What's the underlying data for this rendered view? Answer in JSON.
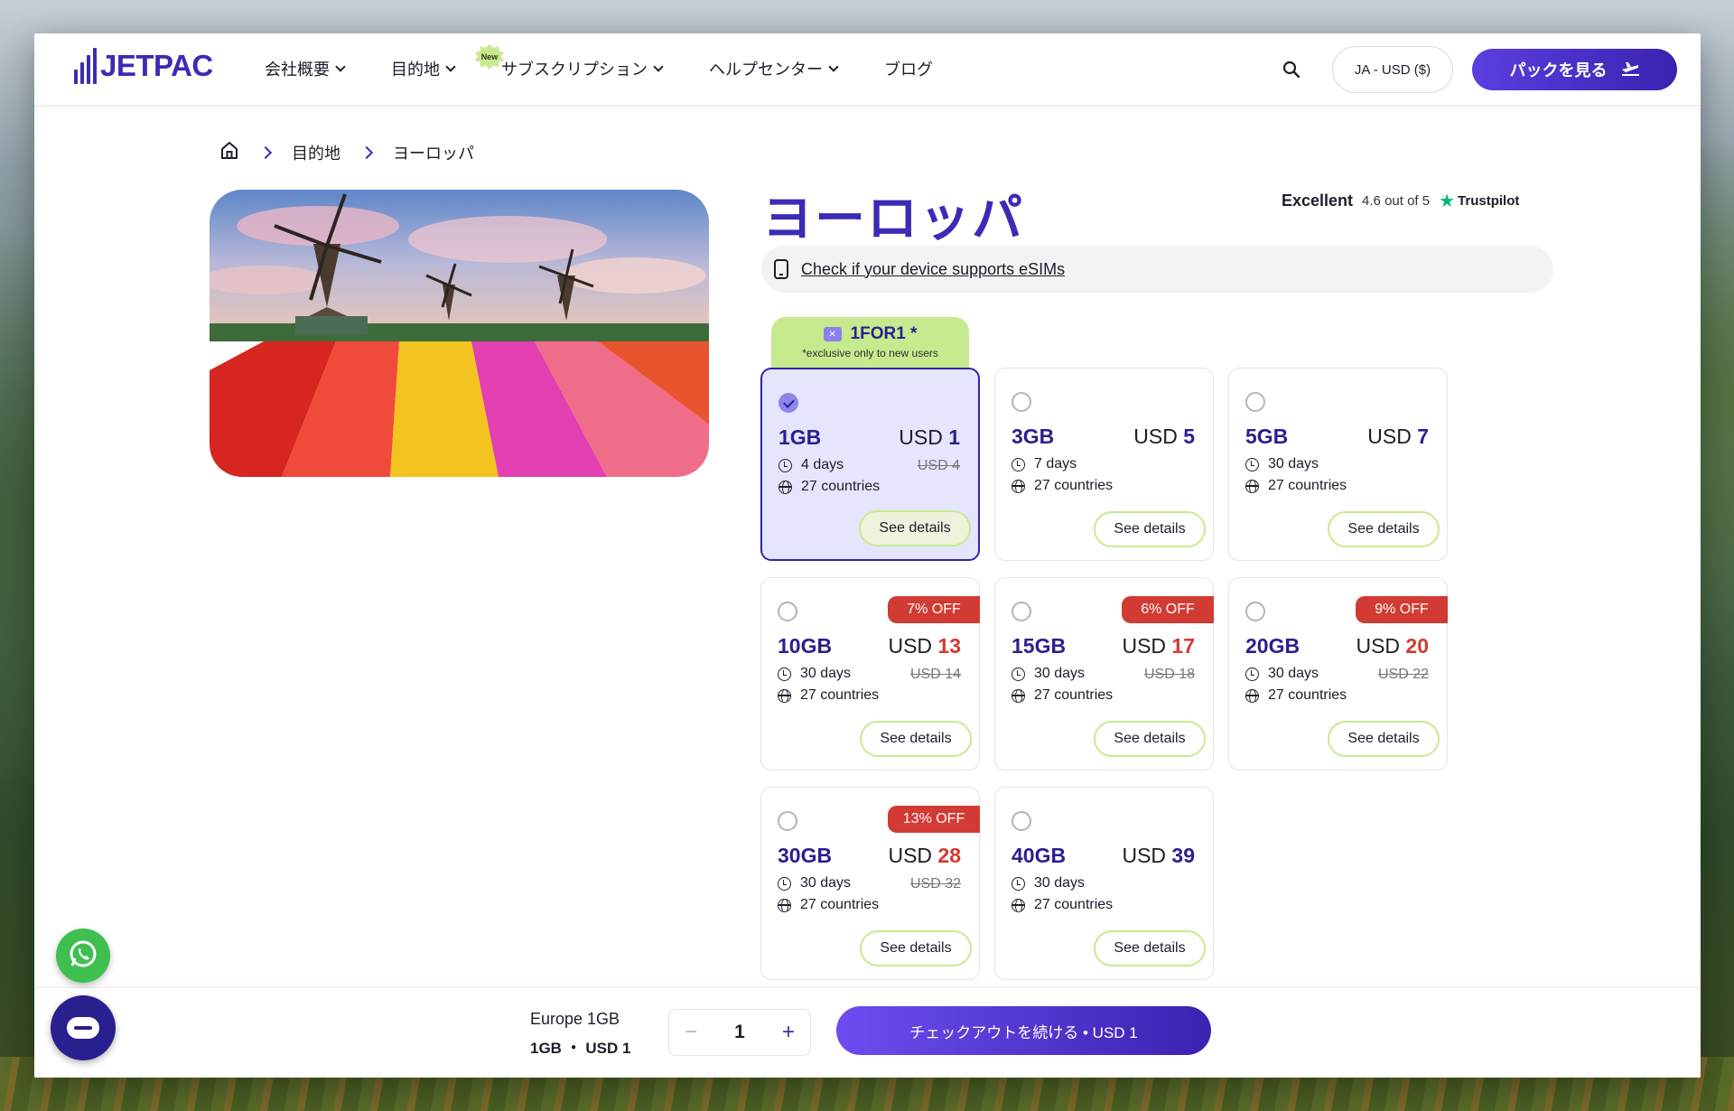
{
  "brand": {
    "name": "JETPAC",
    "accent": "#3b2bb6",
    "sale_color": "#d13b33",
    "promo_color": "#c8ea8f"
  },
  "nav": {
    "items": [
      {
        "label": "会社概要",
        "dropdown": true
      },
      {
        "label": "目的地",
        "dropdown": true
      },
      {
        "label": "サブスクリプション",
        "dropdown": true,
        "badge": "New"
      },
      {
        "label": "ヘルプセンター",
        "dropdown": true
      },
      {
        "label": "ブログ",
        "dropdown": false
      }
    ],
    "search_icon": "search-icon",
    "lang": "JA - USD ($)",
    "cta": "パックを見る"
  },
  "breadcrumb": {
    "home_icon": "home-icon",
    "items": [
      "目的地",
      "ヨーロッパ"
    ]
  },
  "page": {
    "title": "ヨーロッパ",
    "trust": {
      "label": "Excellent",
      "score": "4.6 out of 5",
      "brand": "Trustpilot"
    },
    "esim_check": "Check if your device supports eSIMs"
  },
  "promo": {
    "code": "1FOR1 *",
    "note": "*exclusive only to new users"
  },
  "plans": [
    {
      "gb": "1GB",
      "currency": "USD",
      "price": "1",
      "old": "USD 4",
      "days": "4 days",
      "countries": "27 countries",
      "off": "",
      "selected": true
    },
    {
      "gb": "3GB",
      "currency": "USD",
      "price": "5",
      "old": "",
      "days": "7 days",
      "countries": "27 countries",
      "off": "",
      "selected": false
    },
    {
      "gb": "5GB",
      "currency": "USD",
      "price": "7",
      "old": "",
      "days": "30 days",
      "countries": "27 countries",
      "off": "",
      "selected": false
    },
    {
      "gb": "10GB",
      "currency": "USD",
      "price": "13",
      "old": "USD 14",
      "days": "30 days",
      "countries": "27 countries",
      "off": "7% OFF",
      "selected": false
    },
    {
      "gb": "15GB",
      "currency": "USD",
      "price": "17",
      "old": "USD 18",
      "days": "30 days",
      "countries": "27 countries",
      "off": "6% OFF",
      "selected": false
    },
    {
      "gb": "20GB",
      "currency": "USD",
      "price": "20",
      "old": "USD 22",
      "days": "30 days",
      "countries": "27 countries",
      "off": "9% OFF",
      "selected": false
    },
    {
      "gb": "30GB",
      "currency": "USD",
      "price": "28",
      "old": "USD 32",
      "days": "30 days",
      "countries": "27 countries",
      "off": "13% OFF",
      "selected": false
    },
    {
      "gb": "40GB",
      "currency": "USD",
      "price": "39",
      "old": "",
      "days": "30 days",
      "countries": "27 countries",
      "off": "",
      "selected": false
    }
  ],
  "plan_button": "See details",
  "checkout_bar": {
    "name": "Europe 1GB",
    "summary": "1GB ・ USD 1",
    "quantity": "1",
    "minus": "−",
    "plus": "+",
    "button": "チェックアウトを続ける • USD 1"
  }
}
